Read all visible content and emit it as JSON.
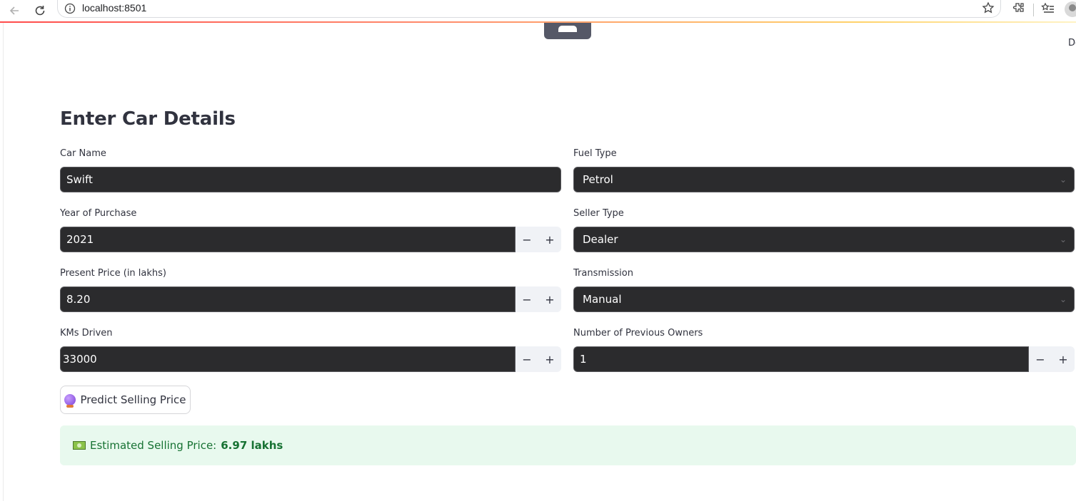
{
  "browser": {
    "url": "localhost:8501"
  },
  "app": {
    "deploy_label": "De"
  },
  "form": {
    "title": "Enter Car Details",
    "car_name": {
      "label": "Car Name",
      "value": "Swift"
    },
    "fuel_type": {
      "label": "Fuel Type",
      "value": "Petrol"
    },
    "year": {
      "label": "Year of Purchase",
      "value": "2021"
    },
    "seller_type": {
      "label": "Seller Type",
      "value": "Dealer"
    },
    "present_price": {
      "label": "Present Price (in lakhs)",
      "value": "8.20"
    },
    "transmission": {
      "label": "Transmission",
      "value": "Manual"
    },
    "kms_driven": {
      "label": "KMs Driven",
      "value": "33000"
    },
    "owners": {
      "label": "Number of Previous Owners",
      "value": "1"
    },
    "stepper": {
      "minus": "−",
      "plus": "+"
    },
    "predict_button": "Predict Selling Price"
  },
  "result": {
    "prefix": "Estimated Selling Price:",
    "value": "6.97 lakhs",
    "color": "#177233",
    "background": "#e8f9ee"
  }
}
